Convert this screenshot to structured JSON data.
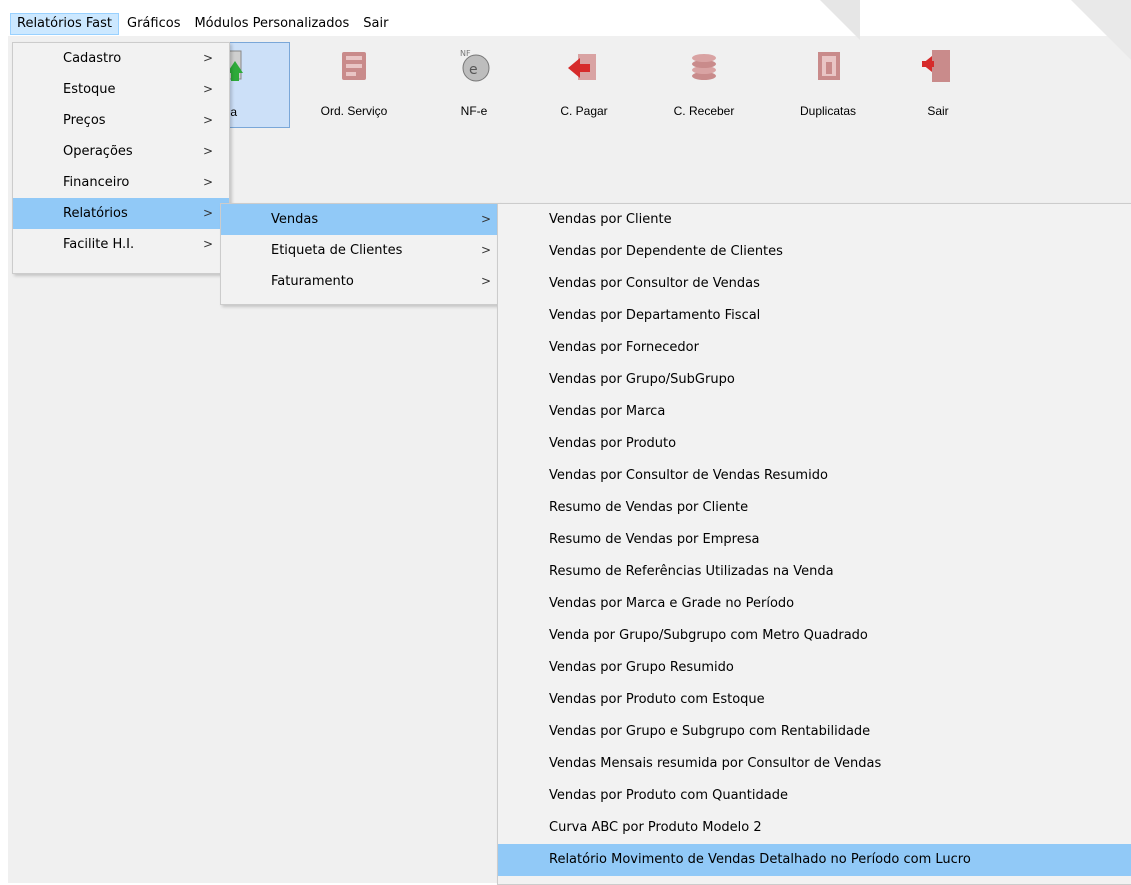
{
  "menubar": {
    "items": [
      "Relatórios Fast",
      "Gráficos",
      "Módulos Personalizados",
      "Sair"
    ]
  },
  "toolbar": {
    "buttons": [
      {
        "label": "rada",
        "icon": "entrada-icon"
      },
      {
        "label": "Ord. Serviço",
        "icon": "ord-servico-icon"
      },
      {
        "label": "NF-e",
        "icon": "nfe-icon"
      },
      {
        "label": "C. Pagar",
        "icon": "contas-pagar-icon"
      },
      {
        "label": "C. Receber",
        "icon": "contas-receber-icon"
      },
      {
        "label": "Duplicatas",
        "icon": "duplicatas-icon"
      },
      {
        "label": "Sair",
        "icon": "exit-door-icon"
      }
    ]
  },
  "menu1": {
    "items": [
      "Cadastro",
      "Estoque",
      "Preços",
      "Operações",
      "Financeiro",
      "Relatórios",
      "Facilite H.I."
    ],
    "arrow": ">"
  },
  "menu2": {
    "items": [
      "Vendas",
      "Etiqueta de Clientes",
      "Faturamento"
    ],
    "arrow": ">"
  },
  "menu3": {
    "items": [
      "Vendas por Cliente",
      "Vendas por Dependente de Clientes",
      "Vendas por Consultor de Vendas",
      "Vendas por Departamento Fiscal",
      "Vendas por Fornecedor",
      "Vendas por Grupo/SubGrupo",
      "Vendas por Marca",
      "Vendas por Produto",
      "Vendas por Consultor de Vendas Resumido",
      "Resumo de Vendas por Cliente",
      "Resumo de Vendas por Empresa",
      "Resumo de Referências Utilizadas na Venda",
      "Vendas por Marca e Grade no Período",
      "Venda por Grupo/Subgrupo com Metro Quadrado",
      "Vendas por Grupo Resumido",
      "Vendas por Produto com Estoque",
      "Vendas por Grupo e Subgrupo com Rentabilidade",
      "Vendas Mensais resumida por Consultor de Vendas",
      "Vendas por Produto com Quantidade",
      "Curva ABC por Produto Modelo 2",
      "Relatório Movimento de Vendas Detalhado no Período com Lucro"
    ]
  },
  "colors": {
    "menu_highlight": "#91c9f7",
    "menubar_active": "#cce8ff",
    "menu_bg": "#f2f2f2"
  }
}
